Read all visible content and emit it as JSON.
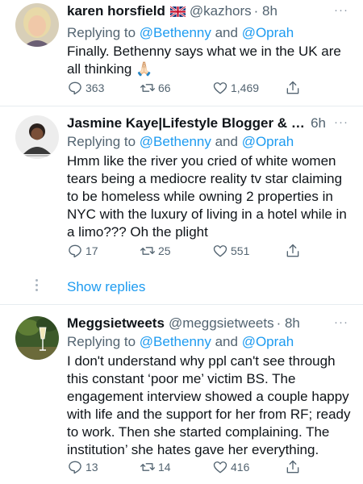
{
  "tweets": [
    {
      "name": "karen horsfield",
      "flag": "uk-flag-emoji",
      "handle": "@kazhors",
      "time": "· 8h",
      "replying_prefix": "Replying to ",
      "mention1": "@Bethenny",
      "and": " and ",
      "mention2": "@Oprah",
      "text": "Finally. Bethenny says what we in the UK are all thinking 🙏🏻",
      "replies": "363",
      "retweets": "66",
      "likes": "1,469"
    },
    {
      "name": "Jasmine Kaye|Lifestyle Blogger & C...",
      "handle": "",
      "time": "6h",
      "replying_prefix": "Replying to ",
      "mention1": "@Bethenny",
      "and": " and ",
      "mention2": "@Oprah",
      "text": "Hmm like the river you cried of white women tears being a mediocre reality tv star claiming to be homeless while owning 2 properties in NYC with the luxury of living in a hotel while in a limo??? Oh the plight",
      "replies": "17",
      "retweets": "25",
      "likes": "551"
    },
    {
      "name": "Meggsietweets",
      "handle": "@meggsietweets",
      "time": "· 8h",
      "replying_prefix": "Replying to ",
      "mention1": "@Bethenny",
      "and": " and ",
      "mention2": "@Oprah",
      "text": "I don't understand why ppl can't see through this constant ‘poor me’  victim BS. The engagement interview showed a couple happy with life and the support for her from RF; ready to work.  Then she started complaining. The institution’ she hates gave her everything.",
      "replies": "13",
      "retweets": "14",
      "likes": "416"
    }
  ],
  "show_replies": "Show replies",
  "more_glyph": "···",
  "icons": [
    "reply-icon",
    "retweet-icon",
    "like-icon",
    "share-icon",
    "more-icon"
  ],
  "colors": {
    "link": "#1d9bf0",
    "secondary": "#536471",
    "divider": "#e6ecf0"
  }
}
